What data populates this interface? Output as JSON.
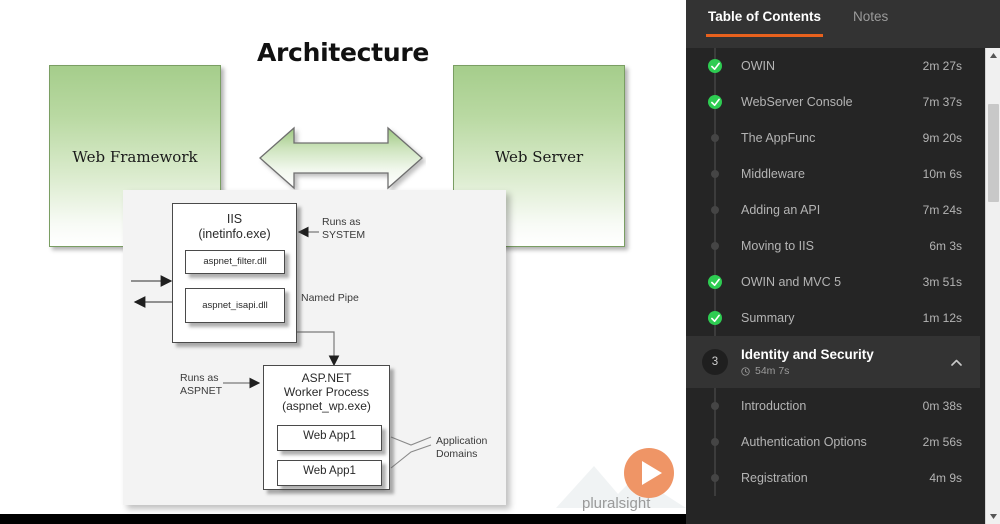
{
  "slide": {
    "title": "Architecture",
    "box_left_label": "Web Framework",
    "box_right_label": "Web Server",
    "arrow_icon": "double-headed-arrow-icon",
    "iis": {
      "title_line1": "IIS",
      "title_line2": "(inetinfo.exe)",
      "dll1": "aspnet_filter.dll",
      "dll2": "aspnet_isapi.dll",
      "note_runs_as_system": "Runs as\nSYSTEM",
      "note_named_pipe": "Named Pipe"
    },
    "worker": {
      "title_line1": "ASP.NET",
      "title_line2": "Worker Process",
      "title_line3": "(aspnet_wp.exe)",
      "app1": "Web App1",
      "app2": "Web App1",
      "note_runs_as_aspnet": "Runs as\nASPNET",
      "note_app_domains": "Application\nDomains"
    },
    "watermark": {
      "brand": "pluralsight",
      "play_icon": "play-icon"
    }
  },
  "sidebar": {
    "tabs": [
      {
        "label": "Table of Contents",
        "active": true
      },
      {
        "label": "Notes",
        "active": false
      }
    ],
    "accent_color": "#e8611d",
    "completed_color": "#2ecc52",
    "items_top": [
      {
        "title": "OWIN",
        "duration": "2m 27s",
        "state": "done"
      },
      {
        "title": "WebServer Console",
        "duration": "7m 37s",
        "state": "done"
      },
      {
        "title": "The AppFunc",
        "duration": "9m 20s",
        "state": "pending"
      },
      {
        "title": "Middleware",
        "duration": "10m 6s",
        "state": "pending"
      },
      {
        "title": "Adding an API",
        "duration": "7m 24s",
        "state": "pending"
      },
      {
        "title": "Moving to IIS",
        "duration": "6m 3s",
        "state": "pending"
      },
      {
        "title": "OWIN and MVC 5",
        "duration": "3m 51s",
        "state": "done"
      },
      {
        "title": "Summary",
        "duration": "1m 12s",
        "state": "done"
      }
    ],
    "module": {
      "number": "3",
      "title": "Identity and Security",
      "duration": "54m 7s",
      "clock_icon": "clock-icon",
      "chevron_icon": "chevron-up-icon",
      "expanded": true
    },
    "items_bottom": [
      {
        "title": "Introduction",
        "duration": "0m 38s",
        "state": "pending"
      },
      {
        "title": "Authentication Options",
        "duration": "2m 56s",
        "state": "pending"
      },
      {
        "title": "Registration",
        "duration": "4m 9s",
        "state": "pending"
      }
    ],
    "scrollbar": {
      "up_icon": "scroll-up-icon",
      "down_icon": "scroll-down-icon"
    }
  }
}
